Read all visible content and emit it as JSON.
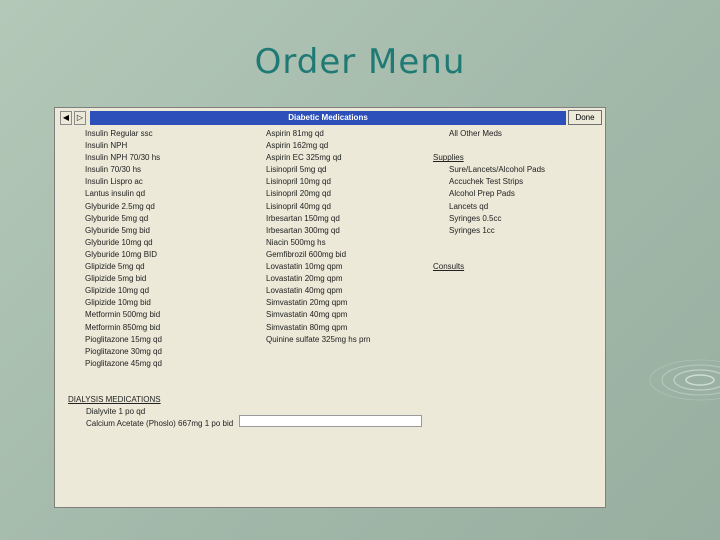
{
  "slide": {
    "title": "Order Menu"
  },
  "window": {
    "title": "Diabetic Medications",
    "done_label": "Done",
    "prev_glyph": "◀",
    "next_glyph": "▷"
  },
  "column1": [
    "Insulin Regular ssc",
    "Insulin NPH",
    "Insulin NPH 70/30 hs",
    "Insulin 70/30 hs",
    "Insulin Lispro ac",
    "Lantus insulin qd",
    "Glyburide 2.5mg qd",
    "Glyburide 5mg qd",
    "Glyburide 5mg bid",
    "Glyburide 10mg qd",
    "Glyburide 10mg BID",
    "Glipizide 5mg qd",
    "Glipizide 5mg bid",
    "Glipizide 10mg qd",
    "Glipizide 10mg bid",
    "Metformin 500mg bid",
    "Metformin 850mg bid",
    "Pioglitazone 15mg qd",
    "Pioglitazone 30mg qd",
    "Pioglitazone 45mg qd"
  ],
  "column2": [
    "Aspirin 81mg qd",
    "Aspirin 162mg qd",
    "Aspirin EC 325mg qd",
    "Lisinopril 5mg qd",
    "Lisinopril 10mg qd",
    "Lisinopril 20mg qd",
    "Lisinopril 40mg qd",
    "Irbesartan 150mg qd",
    "Irbesartan 300mg qd",
    "Niacin 500mg hs",
    "Gemfibrozil 600mg bid",
    "Lovastatin 10mg qpm",
    "Lovastatin 20mg qpm",
    "Lovastatin 40mg qpm",
    "Simvastatin 20mg qpm",
    "Simvastatin 40mg qpm",
    "Simvastatin 80mg qpm",
    "Quinine sulfate 325mg hs prn"
  ],
  "column3": {
    "other_meds": "All Other Meds",
    "supplies_header": "Supplies",
    "supplies": [
      "Sure/Lancets/Alcohol Pads",
      "Accuchek Test Strips",
      "Alcohol Prep Pads",
      "Lancets qd",
      "Syringes 0.5cc",
      "Syringes 1cc"
    ],
    "consult_header": "Consults"
  },
  "dialysis": {
    "header": "DIALYSIS MEDICATIONS",
    "items": [
      "Dialyvite 1 po qd",
      "Calcium Acetate (Phoslo) 667mg 1 po bid"
    ]
  }
}
